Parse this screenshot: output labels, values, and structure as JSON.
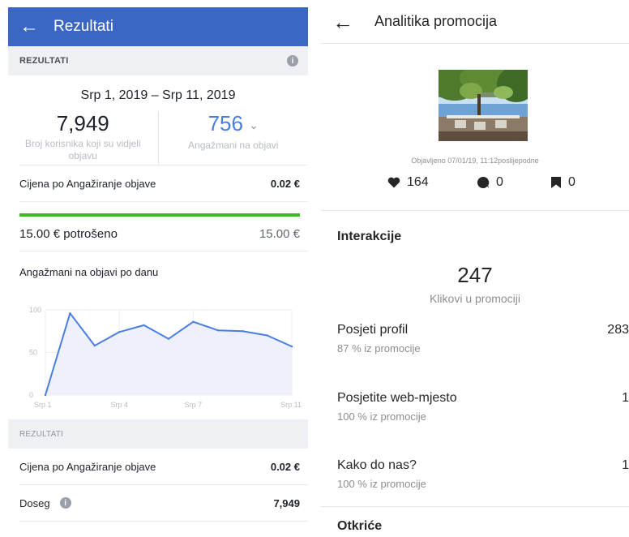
{
  "left": {
    "header": {
      "back_icon": "arrow-left-icon",
      "title": "Rezultati"
    },
    "section1_label": "REZULTATI",
    "date_range": "Srp 1, 2019 – Srp 11, 2019",
    "stat_reach": {
      "value": "7,949",
      "label": "Broj korisnika koji su vidjeli objavu"
    },
    "stat_engagement": {
      "value": "756",
      "label": "Angažmani na objavi"
    },
    "cost_row": {
      "label": "Cijena po Angažiranje objave",
      "value": "0.02 €"
    },
    "budget": {
      "spent_label": "15.00 € potrošeno",
      "total": "15.00 €",
      "progress": 1.0
    },
    "chart_title": "Angažmani na objavi po danu",
    "section2_label": "REZULTATI",
    "cost_row2": {
      "label": "Cijena po Angažiranje objave",
      "value": "0.02 €"
    },
    "doseg_row": {
      "label": "Doseg",
      "value": "7,949"
    },
    "accent": "#3b67c4",
    "progress_color": "#42b72a"
  },
  "chart_data": {
    "type": "area",
    "title": "Angažmani na objavi po danu",
    "x": [
      1,
      2,
      3,
      4,
      5,
      6,
      7,
      8,
      9,
      10,
      11
    ],
    "values": [
      0,
      96,
      58,
      74,
      82,
      66,
      86,
      76,
      75,
      70,
      57
    ],
    "x_tick_labels": [
      "Srp 1",
      "Srp 4",
      "Srp 7",
      "Srp 11"
    ],
    "x_tick_positions": [
      1,
      4,
      7,
      11
    ],
    "y_ticks": [
      0,
      50,
      100
    ],
    "ylim": [
      0,
      100
    ],
    "grid": true,
    "color": "#4a7de0",
    "fill": "#eef1fb"
  },
  "right": {
    "header": {
      "back_icon": "arrow-left-icon",
      "title": "Analitika promocija"
    },
    "posted": "Objavljeno 07/01/19, 11:12poslijepodne",
    "metrics": [
      {
        "icon": "heart-icon",
        "value": "164"
      },
      {
        "icon": "comment-icon",
        "value": "0"
      },
      {
        "icon": "bookmark-icon",
        "value": "0"
      }
    ],
    "interactions_title": "Interakcije",
    "clicks": {
      "value": "247",
      "label": "Klikovi u promociji"
    },
    "rows": [
      {
        "name": "Posjeti profil",
        "pct": "87 % iz promocije",
        "num": "283"
      },
      {
        "name": "Posjetite web-mjesto",
        "pct": "100 % iz promocije",
        "num": "1"
      },
      {
        "name": "Kako do nas?",
        "pct": "100 % iz promocije",
        "num": "1"
      }
    ],
    "discovery_title": "Otkriće"
  }
}
